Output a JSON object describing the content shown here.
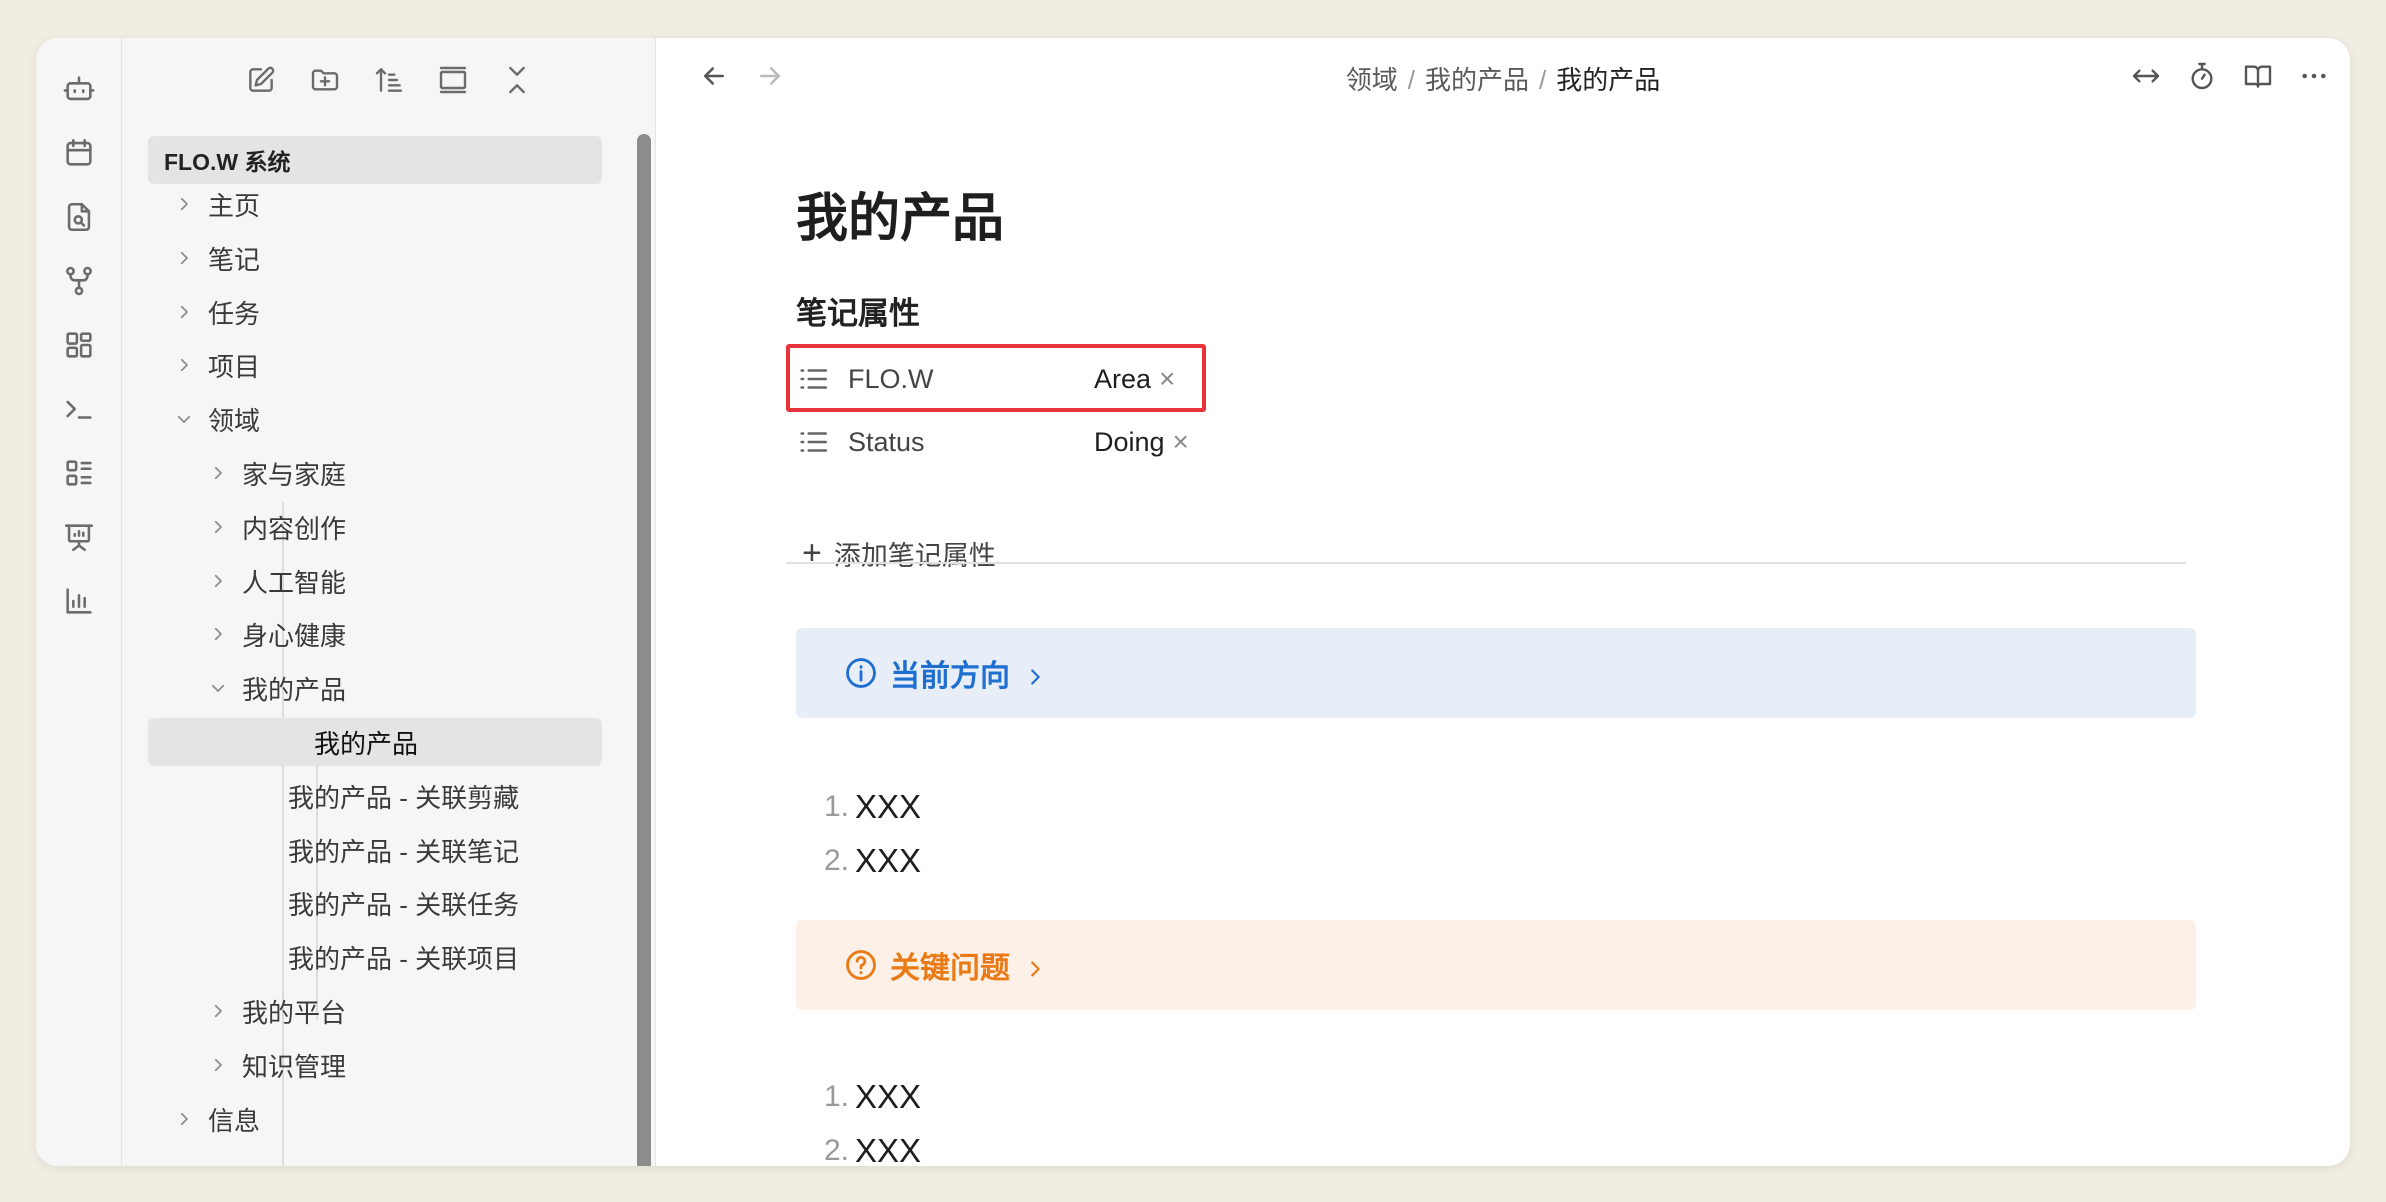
{
  "colors": {
    "highlight": "#e8323c",
    "info_callout_bg": "#e8eef8",
    "info_callout_fg": "#1f6fd1",
    "question_callout_bg": "#fdf0e6",
    "question_callout_fg": "#ea7a16"
  },
  "ribbon": {
    "icons": [
      "bot-icon",
      "calendar-icon",
      "file-search-icon",
      "git-fork-icon",
      "layout-grid-icon",
      "terminal-icon",
      "list-layout-icon",
      "presentation-icon",
      "bar-chart-icon"
    ]
  },
  "sidebar": {
    "toolbar": [
      "new-note-icon",
      "new-folder-icon",
      "sort-icon",
      "collapse-view-icon",
      "collapse-all-icon"
    ],
    "vault_name": "FLO.W 系统",
    "tree": [
      {
        "label": "主页",
        "level": 0,
        "expanded": false
      },
      {
        "label": "笔记",
        "level": 0,
        "expanded": false
      },
      {
        "label": "任务",
        "level": 0,
        "expanded": false
      },
      {
        "label": "项目",
        "level": 0,
        "expanded": false
      },
      {
        "label": "领域",
        "level": 0,
        "expanded": true
      },
      {
        "label": "家与家庭",
        "level": 1,
        "expanded": false
      },
      {
        "label": "内容创作",
        "level": 1,
        "expanded": false
      },
      {
        "label": "人工智能",
        "level": 1,
        "expanded": false
      },
      {
        "label": "身心健康",
        "level": 1,
        "expanded": false
      },
      {
        "label": "我的产品",
        "level": 1,
        "expanded": true
      },
      {
        "label": "我的产品",
        "level": 2,
        "active": true
      },
      {
        "label": "我的产品 - 关联剪藏",
        "level": 2
      },
      {
        "label": "我的产品 - 关联笔记",
        "level": 2
      },
      {
        "label": "我的产品 - 关联任务",
        "level": 2
      },
      {
        "label": "我的产品 - 关联项目",
        "level": 2
      },
      {
        "label": "我的平台",
        "level": 1,
        "expanded": false
      },
      {
        "label": "知识管理",
        "level": 1,
        "expanded": false
      },
      {
        "label": "信息",
        "level": 0,
        "expanded": false
      }
    ]
  },
  "topbar": {
    "breadcrumb": [
      "领域",
      "我的产品",
      "我的产品"
    ],
    "separator": "/"
  },
  "note": {
    "title": "我的产品",
    "properties_heading": "笔记属性",
    "properties": [
      {
        "key": "FLO.W",
        "value": "Area"
      },
      {
        "key": "Status",
        "value": "Doing"
      }
    ],
    "add_property_label": "添加笔记属性",
    "callout_direction": "当前方向",
    "list1": [
      "XXX",
      "XXX"
    ],
    "callout_question": "关键问题",
    "list2": [
      "XXX",
      "XXX"
    ]
  }
}
